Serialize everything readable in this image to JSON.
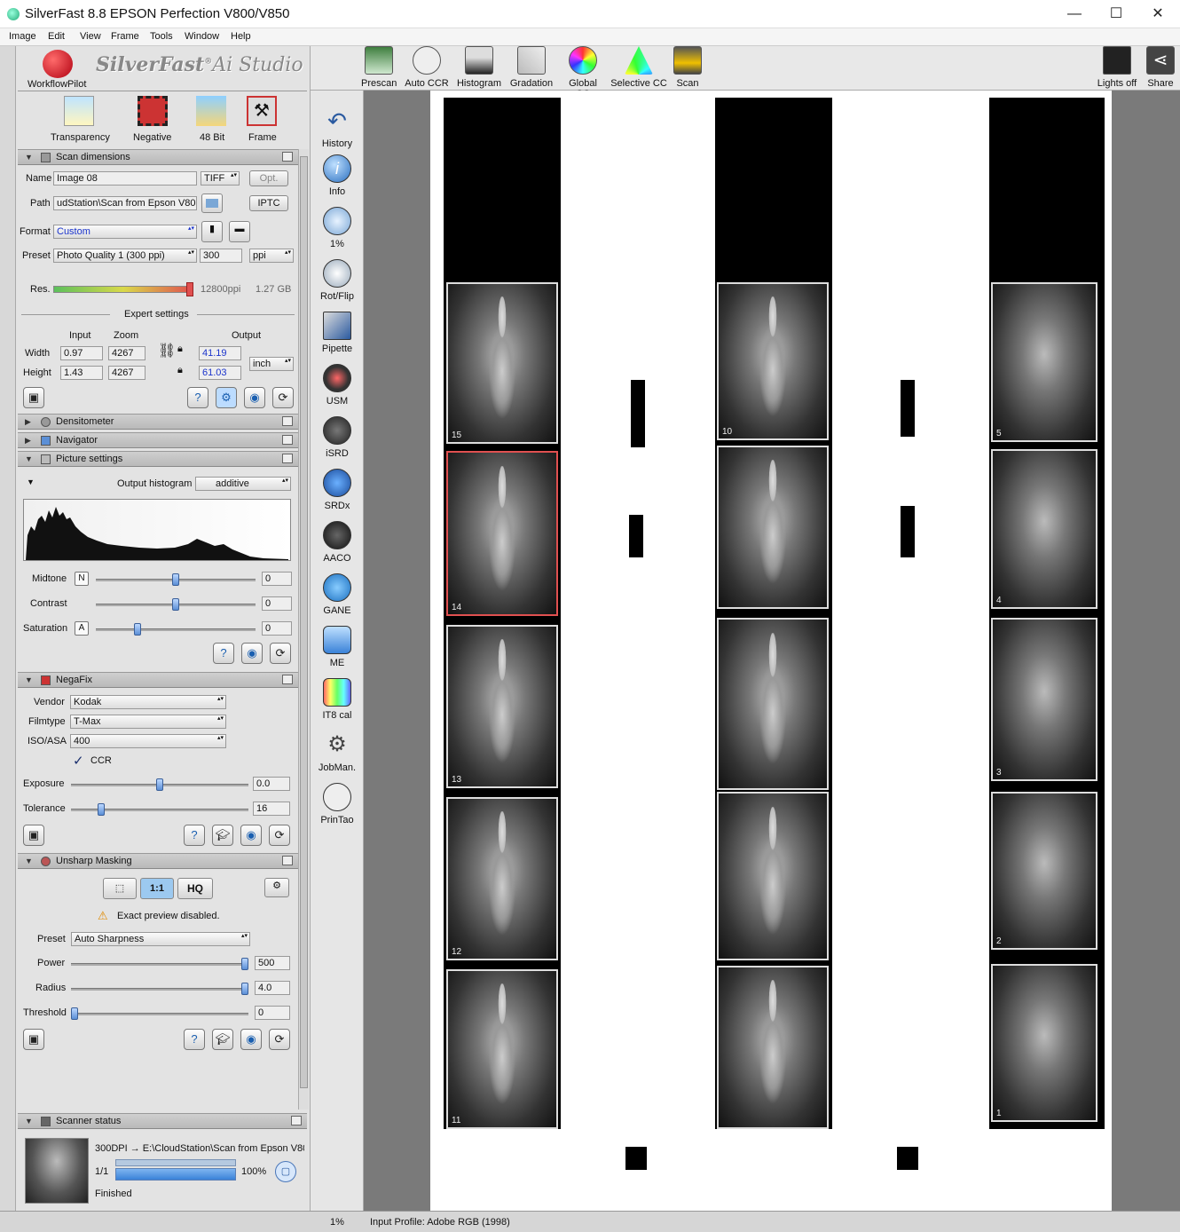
{
  "window": {
    "title": "SilverFast 8.8 EPSON Perfection V800/V850",
    "minimize": "—",
    "maximize": "☐",
    "close": "✕"
  },
  "menu": [
    "Image",
    "Edit",
    "View",
    "Frame",
    "Tools",
    "Window",
    "Help"
  ],
  "brand": {
    "logo_text": "SilverFast",
    "logo_sup": "®",
    "logo_suffix": "Ai Studio",
    "workflow_label": "WorkflowPilot"
  },
  "modes": [
    {
      "label": "Transparency"
    },
    {
      "label": "Negative"
    },
    {
      "label": "48 Bit"
    },
    {
      "label": "Frame"
    }
  ],
  "scan_dimensions": {
    "header": "Scan dimensions",
    "name_label": "Name",
    "name_value": "Image 08",
    "file_type": "TIFF",
    "opt_label": "Opt.",
    "path_label": "Path",
    "path_value": "udStation\\Scan from Epson V800",
    "iptc_label": "IPTC",
    "format_label": "Format",
    "format_value": "Custom",
    "preset_label": "Preset",
    "preset_value": "Photo Quality 1 (300 ppi)",
    "preset_res": "300",
    "preset_unit": "ppi",
    "res_label": "Res.",
    "res_ppi": "12800ppi",
    "res_size": "1.27 GB",
    "res_level": 1.0,
    "expert_label": "Expert settings",
    "col_input": "Input",
    "col_zoom": "Zoom",
    "col_output": "Output",
    "width_label": "Width",
    "width_input": "0.97",
    "width_zoom": "4267",
    "width_output": "41.19",
    "height_label": "Height",
    "height_input": "1.43",
    "height_zoom": "4267",
    "height_output": "61.03",
    "unit": "inch"
  },
  "panels": {
    "densitometer": "Densitometer",
    "navigator": "Navigator",
    "picture_settings": "Picture settings"
  },
  "picture": {
    "histogram_label": "Output histogram",
    "histogram_mode": "additive",
    "midtone_label": "Midtone",
    "midtone_btn": "N",
    "midtone_value": "0",
    "midtone_level": 0.5,
    "contrast_label": "Contrast",
    "contrast_value": "0",
    "contrast_level": 0.5,
    "saturation_label": "Saturation",
    "saturation_btn": "A",
    "saturation_value": "0",
    "saturation_level": 0.26
  },
  "negafix": {
    "header": "NegaFix",
    "vendor_label": "Vendor",
    "vendor_value": "Kodak",
    "filmtype_label": "Filmtype",
    "filmtype_value": "T-Max",
    "iso_label": "ISO/ASA",
    "iso_value": "400",
    "ccr_label": "CCR",
    "ccr_check": "✓",
    "exposure_label": "Exposure",
    "exposure_value": "0.0",
    "exposure_level": 0.5,
    "tolerance_label": "Tolerance",
    "tolerance_value": "16",
    "tolerance_level": 0.17
  },
  "usm": {
    "header": "Unsharp Masking",
    "mode_hq": "HQ",
    "mode_11": "1:1",
    "warning": "Exact preview disabled.",
    "preset_label": "Preset",
    "preset_value": "Auto Sharpness",
    "power_label": "Power",
    "power_value": "500",
    "power_level": 1.0,
    "radius_label": "Radius",
    "radius_value": "4.0",
    "radius_level": 1.0,
    "threshold_label": "Threshold",
    "threshold_value": "0",
    "threshold_level": 0.0
  },
  "scanner_status": {
    "header": "Scanner status",
    "path_line": "300DPI → E:\\CloudStation\\Scan from Epson V80",
    "count": "1/1",
    "percent": "100%",
    "progress": 1.0,
    "state": "Finished"
  },
  "toolbar": [
    {
      "label": "Prescan",
      "icon": "prescan-icon"
    },
    {
      "label": "Auto CCR",
      "icon": "auto-ccr-icon"
    },
    {
      "label": "Histogram",
      "icon": "histogram-icon"
    },
    {
      "label": "Gradation",
      "icon": "gradation-icon"
    },
    {
      "label": "Global CC",
      "icon": "global-cc-icon"
    },
    {
      "label": "Selective CC",
      "icon": "selective-cc-icon"
    },
    {
      "label": "Scan",
      "icon": "scan-icon"
    },
    {
      "label": "Lights off",
      "icon": "lights-off-icon"
    },
    {
      "label": "Share",
      "icon": "share-icon"
    }
  ],
  "vtools": [
    {
      "label": "History",
      "icon": "history-icon"
    },
    {
      "label": "Info",
      "icon": "info-icon"
    },
    {
      "label": "1%",
      "icon": "zoom-icon"
    },
    {
      "label": "Rot/Flip",
      "icon": "rotate-flip-icon"
    },
    {
      "label": "Pipette",
      "icon": "pipette-icon"
    },
    {
      "label": "USM",
      "icon": "usm-icon"
    },
    {
      "label": "iSRD",
      "icon": "isrd-icon"
    },
    {
      "label": "SRDx",
      "icon": "srdx-icon"
    },
    {
      "label": "AACO",
      "icon": "aaco-icon"
    },
    {
      "label": "GANE",
      "icon": "gane-icon"
    },
    {
      "label": "ME",
      "icon": "me-icon"
    },
    {
      "label": "IT8 cal",
      "icon": "it8-cal-icon"
    },
    {
      "label": "JobMan.",
      "icon": "jobman-icon"
    },
    {
      "label": "PrinTao",
      "icon": "printao-icon"
    }
  ],
  "frames": {
    "left": [
      "15",
      "14",
      "13",
      "12",
      "11"
    ],
    "middle": [
      "10",
      "",
      "",
      "",
      ""
    ],
    "right": [
      "5",
      "4",
      "3",
      "2",
      "1"
    ]
  },
  "statusbar": {
    "zoom": "1%",
    "profile": "Input Profile: Adobe RGB (1998)"
  }
}
